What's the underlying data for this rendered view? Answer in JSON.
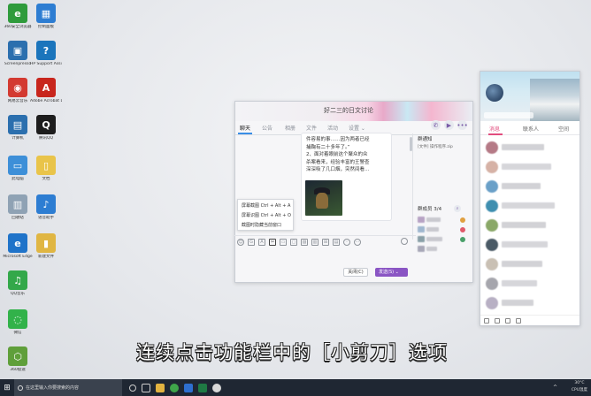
{
  "desktop": {
    "icons": [
      {
        "label": "360安全浏览器",
        "color": "#2f9b3c",
        "glyph": "e"
      },
      {
        "label": "控制面板",
        "color": "#2d7dd2",
        "glyph": "▦"
      },
      {
        "label": "Screenpresso",
        "color": "#2b6fae",
        "glyph": "▣"
      },
      {
        "label": "HP Support Assistant",
        "color": "#1b75bc",
        "glyph": "?"
      },
      {
        "label": "网易云音乐",
        "color": "#d33a31",
        "glyph": "◉"
      },
      {
        "label": "Adobe Acrobat DC",
        "color": "#c8261d",
        "glyph": "A"
      },
      {
        "label": "计算机",
        "color": "#2b6fae",
        "glyph": "▤"
      },
      {
        "label": "腾讯QQ",
        "color": "#1d1d1d",
        "glyph": "Q"
      },
      {
        "label": "此电脑",
        "color": "#3d8fd8",
        "glyph": "▭"
      },
      {
        "label": "文档",
        "color": "#e9c44a",
        "glyph": "▯"
      },
      {
        "label": "回收站",
        "color": "#8fa2b4",
        "glyph": "▥"
      },
      {
        "label": "语音助手",
        "color": "#2d7dd2",
        "glyph": "♪"
      },
      {
        "label": "Microsoft Edge",
        "color": "#1f73c9",
        "glyph": "e"
      },
      {
        "label": "新建文件",
        "color": "#e0b643",
        "glyph": "▮"
      },
      {
        "label": "QQ音乐",
        "color": "#33a84a",
        "glyph": "♫"
      },
      {
        "label": "微信",
        "color": "#32b24a",
        "glyph": "◌"
      },
      {
        "label": "360极速",
        "color": "#5f9f3a",
        "glyph": "⬡"
      }
    ]
  },
  "chat_window": {
    "title": "好二三的日文讨论",
    "tabs": [
      "聊天",
      "公告",
      "相册",
      "文件",
      "活动",
      "设置 ⌄"
    ],
    "message_lines": [
      "件容易的事……因为两者已经",
      "捕鞠有二十多年了。”",
      "2、面对着眼前这个聚众的众",
      "杀案看来，经验丰富的王警查",
      "深深吸了几口烟，突然间看…"
    ],
    "menu": [
      "屏幕截图 Ctrl + Alt + A",
      "屏幕识图 Ctrl + Alt + O",
      "截图时隐藏当前窗口"
    ],
    "group_notice_title": "群通知",
    "group_notice_text": "[文件] 操作程序.zip",
    "members_title": "群成员 3/4",
    "close_label": "关闭(C)",
    "send_label": "发送(S) ⌄"
  },
  "qq_main": {
    "tabs": [
      "消息",
      "联系人",
      "空间"
    ]
  },
  "caption": "连续点击功能栏中的［小剪刀］选项",
  "taskbar": {
    "search_placeholder": "在这里输入你要搜索的内容",
    "tray_temp": "30°C",
    "tray_cpu": "CPU温度"
  }
}
